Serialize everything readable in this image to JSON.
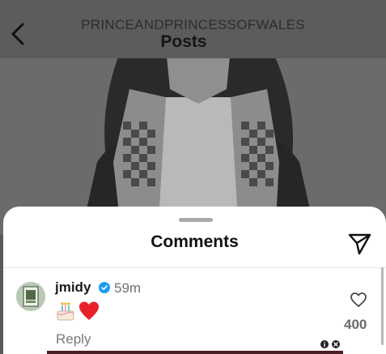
{
  "header": {
    "account": "PRINCEANDPRINCESSOFWALES",
    "title": "Posts",
    "back_icon": "chevron-left-icon"
  },
  "post": {
    "image": "photo-of-woman-in-checked-scarf"
  },
  "comments_sheet": {
    "title": "Comments",
    "share_icon": "paper-plane-icon",
    "comments": [
      {
        "username": "jmidy",
        "verified": true,
        "time": "59m",
        "text_emojis": "🎂❤️",
        "reply_label": "Reply",
        "likes": "400",
        "like_icon": "heart-outline-icon"
      }
    ]
  },
  "colors": {
    "overlay": "#5a5a5a",
    "verified": "#1d9bf0",
    "heart_red": "#e8202a",
    "muted_text": "#737373"
  }
}
